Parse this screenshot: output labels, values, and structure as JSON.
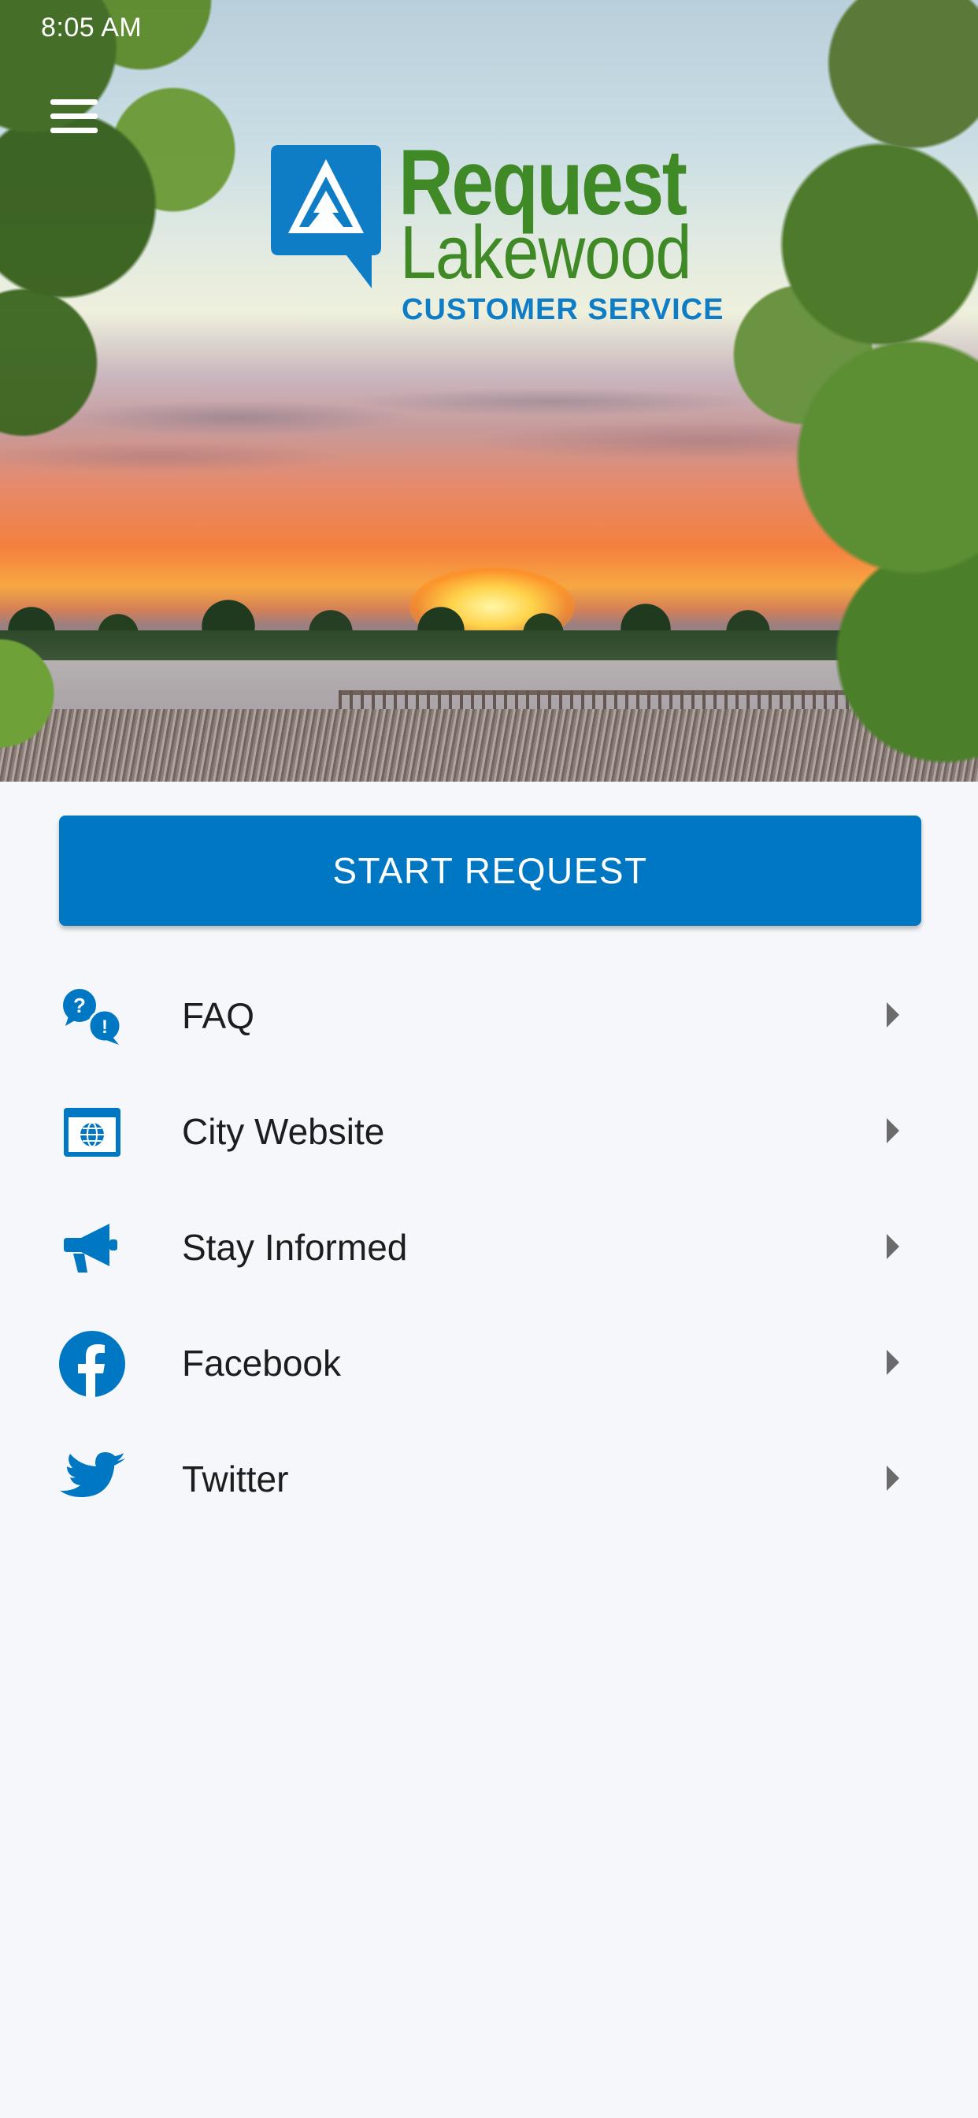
{
  "status_bar": {
    "time": "8:05 AM"
  },
  "header": {
    "menu_icon": "hamburger-menu-icon"
  },
  "logo": {
    "line1": "Request",
    "line2": "Lakewood",
    "line3": "CUSTOMER SERVICE",
    "green": "#3f8a26",
    "blue": "#0f7dc6"
  },
  "primary_action": {
    "label": "START REQUEST",
    "color": "#0077c2"
  },
  "menu": {
    "items": [
      {
        "label": "FAQ",
        "icon": "faq-bubbles-icon"
      },
      {
        "label": "City Website",
        "icon": "web-globe-icon"
      },
      {
        "label": "Stay Informed",
        "icon": "megaphone-icon"
      },
      {
        "label": "Facebook",
        "icon": "facebook-icon"
      },
      {
        "label": "Twitter",
        "icon": "twitter-icon"
      }
    ],
    "icon_color": "#0077c2"
  }
}
